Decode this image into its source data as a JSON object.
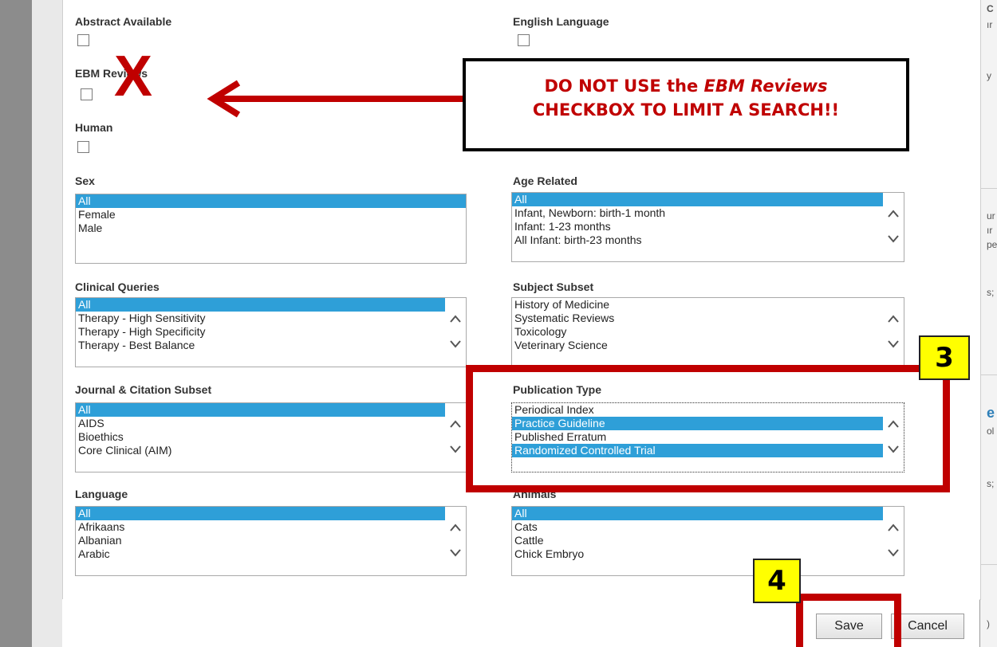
{
  "filters": {
    "abstract_available": "Abstract Available",
    "english_language": "English Language",
    "ebm_reviews": "EBM Reviews",
    "human": "Human"
  },
  "sex": {
    "label": "Sex",
    "options": [
      "All",
      "Female",
      "Male"
    ],
    "selected": [
      "All"
    ]
  },
  "age_related": {
    "label": "Age Related",
    "options": [
      "All",
      "Infant, Newborn: birth-1 month",
      "Infant: 1-23 months",
      "All Infant: birth-23 months"
    ],
    "selected": [
      "All"
    ]
  },
  "clinical_queries": {
    "label": "Clinical Queries",
    "options": [
      "All",
      "Therapy - High Sensitivity",
      "Therapy - High Specificity",
      "Therapy - Best Balance"
    ],
    "selected": [
      "All"
    ]
  },
  "subject_subset": {
    "label": "Subject Subset",
    "options": [
      "History of Medicine",
      "Systematic Reviews",
      "Toxicology",
      "Veterinary Science"
    ],
    "selected": []
  },
  "journal_citation_subset": {
    "label": "Journal & Citation Subset",
    "options": [
      "All",
      "AIDS",
      "Bioethics",
      "Core Clinical (AIM)"
    ],
    "selected": [
      "All"
    ]
  },
  "publication_type": {
    "label": "Publication Type",
    "options": [
      "Periodical Index",
      "Practice Guideline",
      "Published Erratum",
      "Randomized Controlled Trial"
    ],
    "selected": [
      "Practice Guideline",
      "Randomized Controlled Trial"
    ]
  },
  "language": {
    "label": "Language",
    "options": [
      "All",
      "Afrikaans",
      "Albanian",
      "Arabic"
    ],
    "selected": [
      "All"
    ]
  },
  "animals": {
    "label": "Animals",
    "options": [
      "All",
      "Cats",
      "Cattle",
      "Chick Embryo"
    ],
    "selected": [
      "All"
    ]
  },
  "annotation": {
    "callout_line1_prefix": "DO NOT USE the ",
    "callout_line1_italic": "EBM Reviews",
    "callout_line2": "CHECKBOX TO LIMIT A SEARCH!!",
    "x_mark": "X",
    "step3": "3",
    "step4": "4",
    "accent_color": "#c00000",
    "badge_color": "#ffff00"
  },
  "buttons": {
    "save": "Save",
    "cancel": "Cancel"
  },
  "background_fragments": [
    "C",
    "ır",
    "y",
    "ur",
    "ır",
    "pe",
    "s;",
    "e",
    "ol",
    "s;",
    ")"
  ]
}
